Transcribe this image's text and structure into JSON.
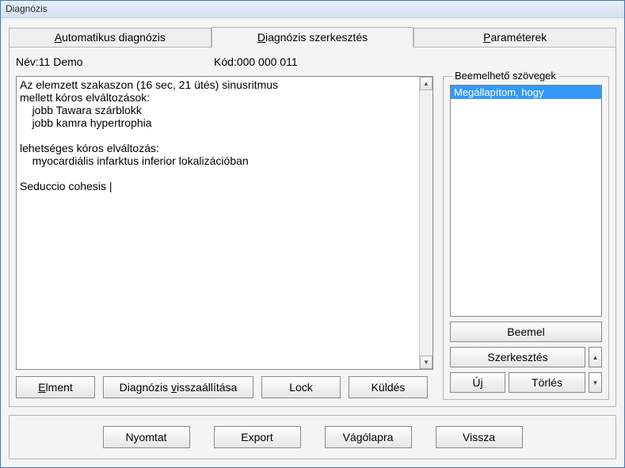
{
  "window": {
    "title": "Diagnózis"
  },
  "tabs": {
    "auto": {
      "pre": "A",
      "rest": "utomatikus diagnózis"
    },
    "edit": {
      "pre": "D",
      "rest": "iagnózis szerkesztés"
    },
    "params": {
      "pre": "P",
      "rest": "araméterek"
    }
  },
  "info": {
    "name_label": "Név:",
    "name_value": "11 Demo",
    "code_label": "Kód:",
    "code_value": "000 000 011"
  },
  "editor": {
    "text": "Az elemzett szakaszon (16 sec, 21 ütés) sinusritmus\nmellett kóros elváltozások:\n    jobb Tawara szárblokk\n    jobb kamra hypertrophia\n\nlehetséges kóros elváltozás:\n    myocardiális infarktus inferior lokalizációban\n\nSeduccio cohesis |"
  },
  "left_buttons": {
    "save": {
      "pre": "E",
      "rest": "lment"
    },
    "restore": {
      "text_pre": "Diagnózis ",
      "u": "v",
      "text_post": "isszaállítása"
    },
    "lock": "Lock",
    "send": "Küldés"
  },
  "group": {
    "title": "Beemelhető szövegek",
    "items": [
      "Megállapítom, hogy"
    ],
    "selected_index": 0,
    "insert": "Beemel",
    "edit": "Szerkesztés",
    "new": "Új",
    "delete": "Törlés"
  },
  "bottom": {
    "print": "Nyomtat",
    "export": "Export",
    "clipboard": "Vágólapra",
    "back": "Vissza"
  }
}
